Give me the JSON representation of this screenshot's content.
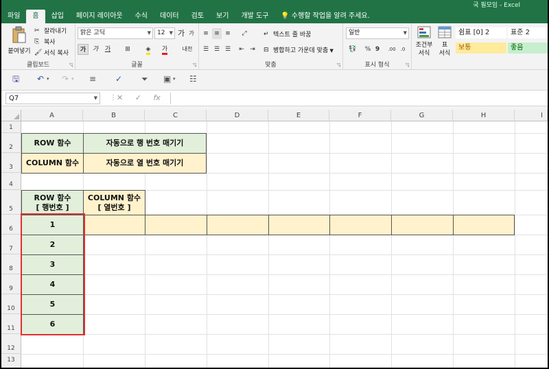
{
  "title_fragment": "국 필모임 - Excel",
  "tabs": [
    "파일",
    "홈",
    "삽입",
    "페이지 레이아웃",
    "수식",
    "데이터",
    "검토",
    "보기",
    "개발 도구"
  ],
  "active_tab": "홈",
  "tell_me": "수행할 작업을 알려 주세요.",
  "clipboard": {
    "paste": "붙여넣기",
    "cut": "잘라내기",
    "copy": "복사",
    "format_painter": "서식 복사",
    "label": "클립보드"
  },
  "font": {
    "name": "맑은 고딕",
    "size": "12",
    "label": "글꼴",
    "grow": "가",
    "shrink": "가",
    "bold": "가",
    "italic": "가",
    "underline": "가",
    "fontcolor": "가",
    "phonetic": "내천"
  },
  "alignment": {
    "wrap": "텍스트 줄 바꿈",
    "merge": "병합하고 가운데 맞춤",
    "label": "맞춤"
  },
  "number": {
    "format": "일반",
    "percent": "%",
    "comma": "9",
    "label": "표시 형식"
  },
  "styles": {
    "cond_line1": "조건부",
    "cond_line2": "서식",
    "table_line1": "표",
    "table_line2": "서식",
    "cells": [
      "쉼표 [0] 2",
      "표준 2",
      "보통",
      "좋음"
    ]
  },
  "name_box": "Q7",
  "formula_icons": {
    "cancel": "✕",
    "enter": "✓",
    "fx": "fx"
  },
  "columns": [
    "A",
    "B",
    "C",
    "D",
    "E",
    "F",
    "G",
    "H",
    "I"
  ],
  "rows": [
    "1",
    "2",
    "3",
    "4",
    "5",
    "6",
    "7",
    "8",
    "9",
    "10",
    "11",
    "12",
    "13"
  ],
  "cells": {
    "a2": "ROW 함수",
    "b2": "자동으로 행 번호 매기기",
    "a3": "COLUMN 함수",
    "b3": "자동으로 열 번호 매기기",
    "a5_l1": "ROW 함수",
    "a5_l2": "[ 행번호 ]",
    "b5_l1": "COLUMN 함수",
    "b5_l2": "[ 열번호 ]",
    "a6": "1",
    "a7": "2",
    "a8": "3",
    "a9": "4",
    "a10": "5",
    "a11": "6"
  },
  "colors": {
    "accent": "#217346",
    "green_fill": "#e2efda",
    "yellow_fill": "#fff2cc",
    "highlight": "#e03030"
  }
}
